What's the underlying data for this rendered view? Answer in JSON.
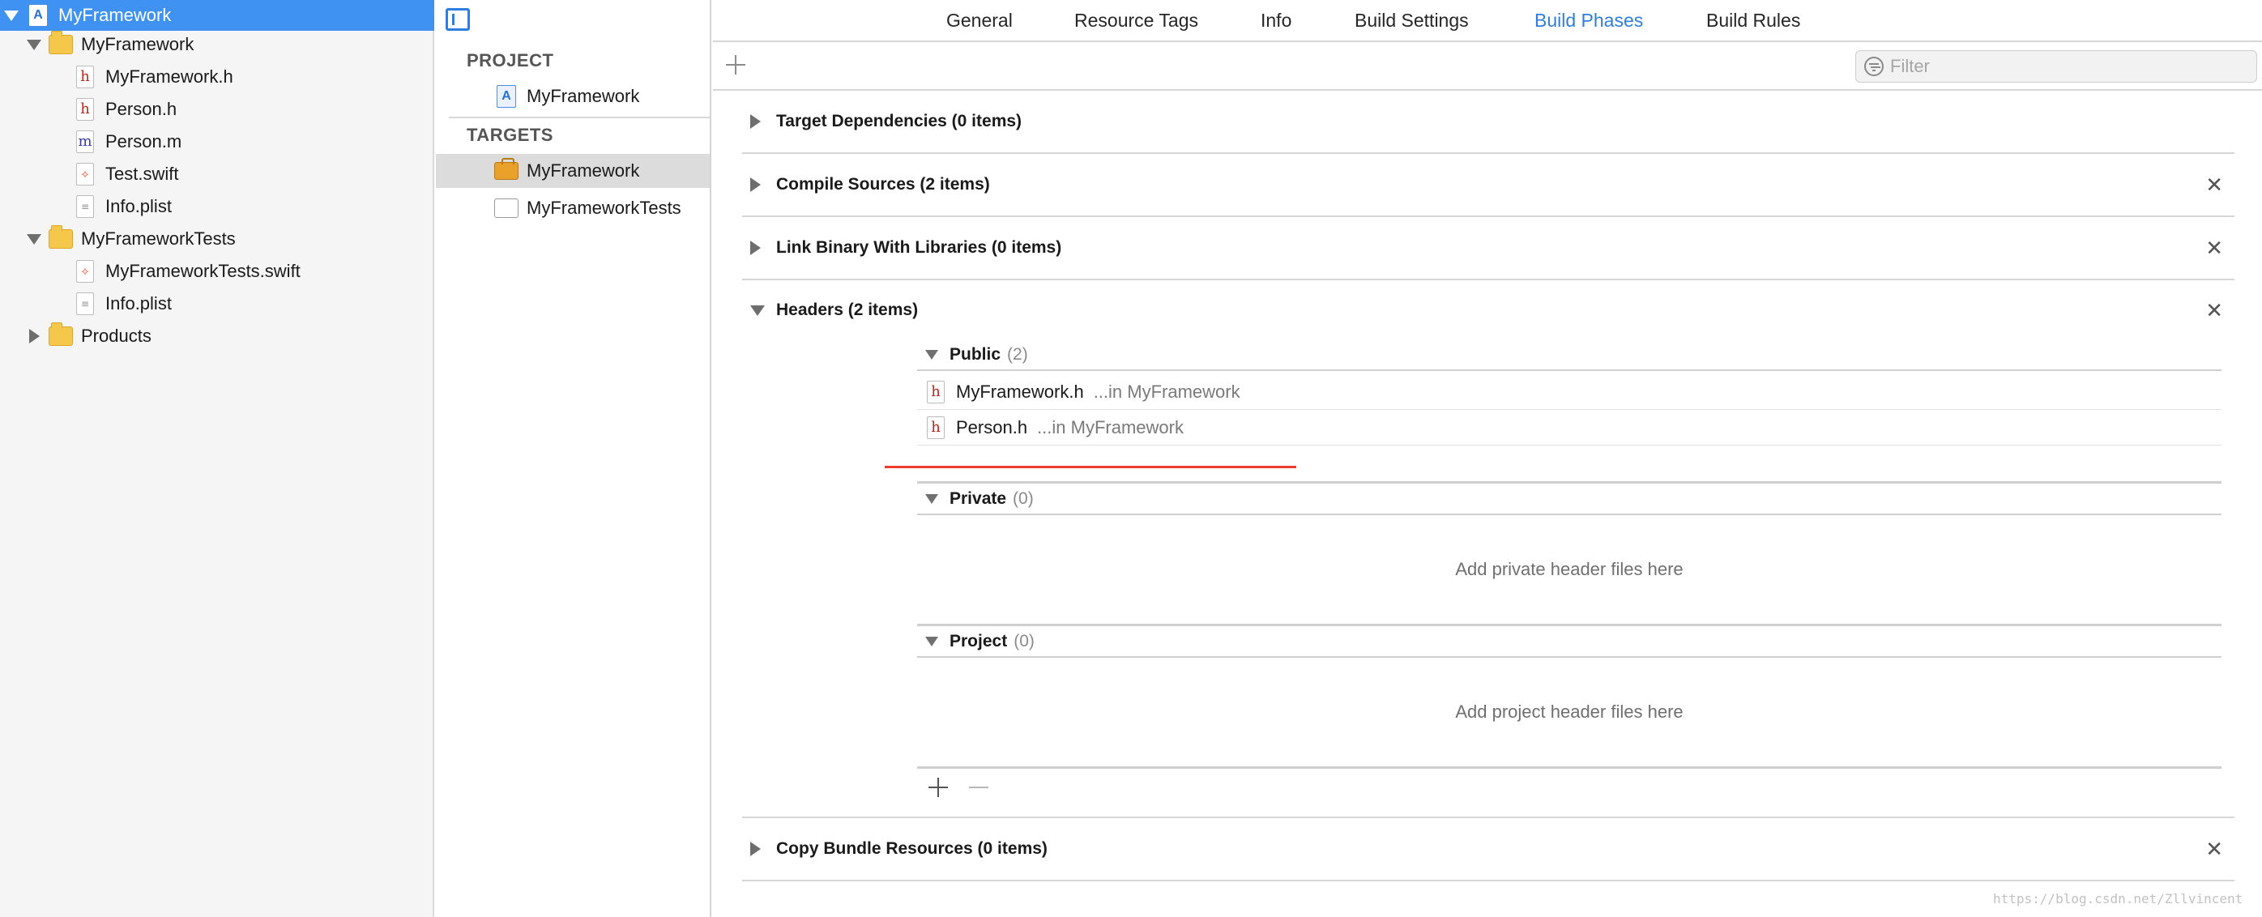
{
  "navigator": {
    "items": [
      {
        "label": "MyFramework",
        "kind": "project",
        "icon": "xcode-project-icon",
        "expanded": true,
        "selected": true
      },
      {
        "label": "MyFramework",
        "kind": "folder",
        "icon": "folder-icon",
        "expanded": true
      },
      {
        "label": "MyFramework.h",
        "kind": "file",
        "icon": "header-file-icon",
        "glyph": "h"
      },
      {
        "label": "Person.h",
        "kind": "file",
        "icon": "header-file-icon",
        "glyph": "h"
      },
      {
        "label": "Person.m",
        "kind": "file",
        "icon": "objc-file-icon",
        "glyph": "m"
      },
      {
        "label": "Test.swift",
        "kind": "file",
        "icon": "swift-file-icon",
        "glyph": "⟡"
      },
      {
        "label": "Info.plist",
        "kind": "file",
        "icon": "plist-file-icon",
        "glyph": "≡"
      },
      {
        "label": "MyFrameworkTests",
        "kind": "folder",
        "icon": "folder-icon",
        "expanded": true
      },
      {
        "label": "MyFrameworkTests.swift",
        "kind": "file",
        "icon": "swift-file-icon",
        "glyph": "⟡"
      },
      {
        "label": "Info.plist",
        "kind": "file",
        "icon": "plist-file-icon",
        "glyph": "≡"
      },
      {
        "label": "Products",
        "kind": "folder",
        "icon": "folder-icon",
        "expanded": false
      }
    ]
  },
  "target_list": {
    "project_header": "PROJECT",
    "project_item": "MyFramework",
    "targets_header": "TARGETS",
    "targets": [
      {
        "label": "MyFramework",
        "icon": "framework-target-icon",
        "selected": true
      },
      {
        "label": "MyFrameworkTests",
        "icon": "test-bundle-icon",
        "selected": false
      }
    ]
  },
  "tabs": [
    {
      "label": "General",
      "active": false
    },
    {
      "label": "Resource Tags",
      "active": false
    },
    {
      "label": "Info",
      "active": false
    },
    {
      "label": "Build Settings",
      "active": false
    },
    {
      "label": "Build Phases",
      "active": true
    },
    {
      "label": "Build Rules",
      "active": false
    }
  ],
  "toolbar": {
    "filter_placeholder": "Filter"
  },
  "phases": {
    "target_dependencies": "Target Dependencies (0 items)",
    "compile_sources": "Compile Sources (2 items)",
    "link_binary": "Link Binary With Libraries (0 items)",
    "headers": "Headers (2 items)",
    "copy_bundle": "Copy Bundle Resources (0 items)",
    "close_glyph": "✕"
  },
  "headers": {
    "public": {
      "name": "Public",
      "count": "(2)"
    },
    "public_files": [
      {
        "name": "MyFramework.h",
        "location": "...in MyFramework"
      },
      {
        "name": "Person.h",
        "location": "...in MyFramework"
      }
    ],
    "private": {
      "name": "Private",
      "count": "(0)",
      "empty": "Add private header files here"
    },
    "project": {
      "name": "Project",
      "count": "(0)",
      "empty": "Add project header files here"
    }
  },
  "colors": {
    "accent": "#2f7de1",
    "selection": "#3f92f1",
    "annotation_red": "#ef3b2d"
  },
  "watermark": "https://blog.csdn.net/Zllvincent"
}
